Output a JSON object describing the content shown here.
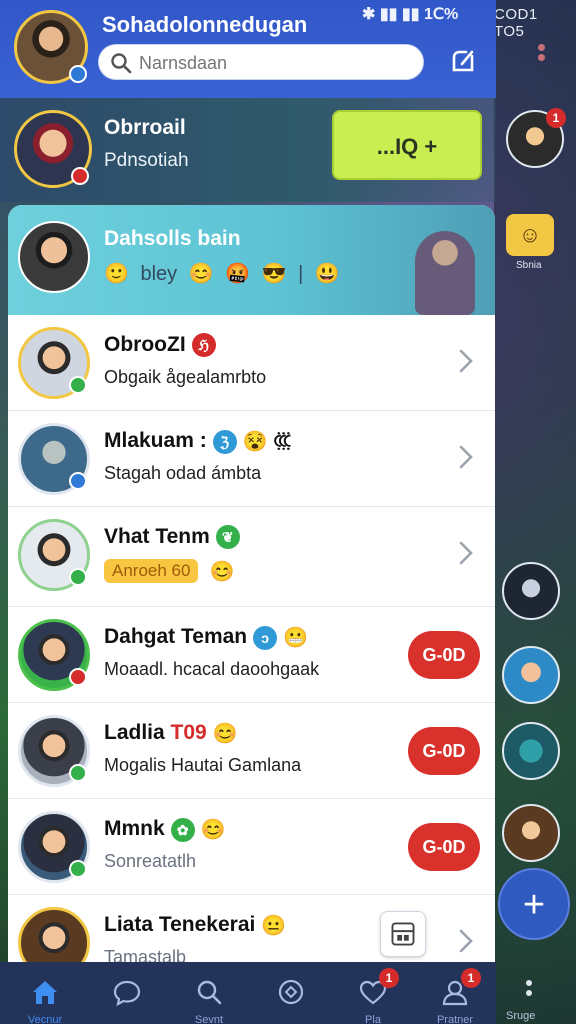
{
  "status_bar": {
    "left": "✱ ▮▮ ▮▮ 1Ⅽ%",
    "right": "COD1 TO5"
  },
  "header": {
    "title": "Sohadolonnedugan",
    "search_placeholder": "Narnsdaan"
  },
  "featured": {
    "name": "Obrroail",
    "subtitle": "Pdnsotiah",
    "action_label": "...IQ +"
  },
  "group": {
    "name": "Dahsolls bain",
    "emojis": [
      "🙂",
      "bley",
      "😊",
      "🤬",
      "😎",
      "|",
      "😃"
    ]
  },
  "chats": [
    {
      "name": "ObrooZI",
      "preview": "Obgaik ågealamrbto",
      "badge": "ℌ",
      "badge_color": "#d62b2b",
      "action": "chevron"
    },
    {
      "name": "Mlakuam :",
      "preview": "Stagah odad ámbta",
      "badge": "ℨ",
      "badge_color": "#2f9ad6",
      "extra_emoji": "😵 ꘚ",
      "action": "chevron"
    },
    {
      "name": "Vhat Tenm",
      "preview_chip": "Anroeh 60",
      "preview_emoji": "😊",
      "badge": "❦",
      "badge_color": "#33b04a",
      "action": "chevron"
    },
    {
      "name": "Dahgat Teman",
      "preview": "Moaadl. hcacal daoohgaak",
      "badge": "ↄ",
      "badge_color": "#2f9ad6",
      "extra_emoji": "😬",
      "action": "pill",
      "pill_label": "G-0D"
    },
    {
      "name": "Ladlia",
      "name_accent": "T09",
      "extra_emoji": "😊",
      "preview": "Mogalis Hautai Gamlana",
      "action": "pill",
      "pill_label": "G-0D"
    },
    {
      "name": "Mmnk",
      "preview": "Sonreatatlh",
      "badge": "✿",
      "badge_color": "#33b04a",
      "extra_emoji": "😊",
      "action": "pill",
      "pill_label": "G-0D"
    },
    {
      "name": "Liata Tenekerai",
      "preview": "Tamastalb",
      "extra_emoji": "😐",
      "action": "chevron"
    }
  ],
  "right_strip": {
    "badge_count": "1",
    "emoji_label": "Sbnia",
    "bottom_label": "Sruge"
  },
  "tabbar": {
    "tabs": [
      {
        "label": "Vecnur",
        "icon": "home-icon",
        "badge": ""
      },
      {
        "label": "",
        "icon": "chat-icon",
        "badge": ""
      },
      {
        "label": "Sevnt",
        "icon": "search-icon",
        "badge": ""
      },
      {
        "label": "",
        "icon": "compass-icon",
        "badge": ""
      },
      {
        "label": "Pla",
        "icon": "heart-icon",
        "badge": "1"
      },
      {
        "label": "Pratner",
        "icon": "profile-icon",
        "badge": "1"
      }
    ]
  },
  "colors": {
    "header_blue": "#3157c9",
    "featured_green": "#c9ee52",
    "pill_red": "#d9312b",
    "tabbar": "#23335a",
    "group_cyan": "#6fd0dc"
  }
}
